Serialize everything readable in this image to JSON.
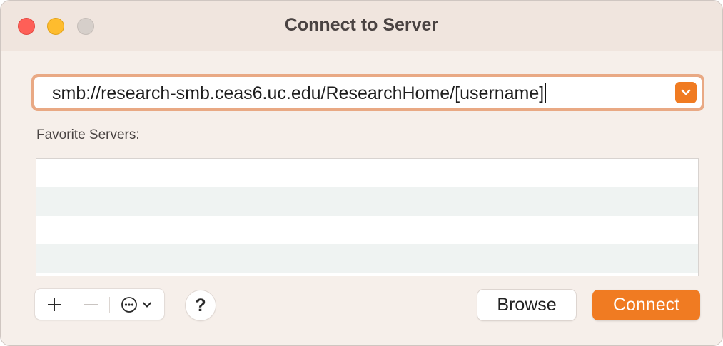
{
  "window": {
    "title": "Connect to Server"
  },
  "address": {
    "value": "smb://research-smb.ceas6.uc.edu/ResearchHome/[username]"
  },
  "favorites": {
    "label": "Favorite Servers:",
    "items": []
  },
  "toolbar": {
    "add_symbol": "+",
    "remove_symbol": "−",
    "help_symbol": "?"
  },
  "buttons": {
    "browse": "Browse",
    "connect": "Connect"
  },
  "colors": {
    "accent": "#f07b22",
    "close": "#fe5f57",
    "minimize": "#febc2e",
    "zoom_disabled": "#d6cfca"
  },
  "icons": {
    "dropdown": "chevron-down-icon",
    "more_options": "ellipsis-circle-icon",
    "more_options_arrow": "chevron-down-icon"
  }
}
